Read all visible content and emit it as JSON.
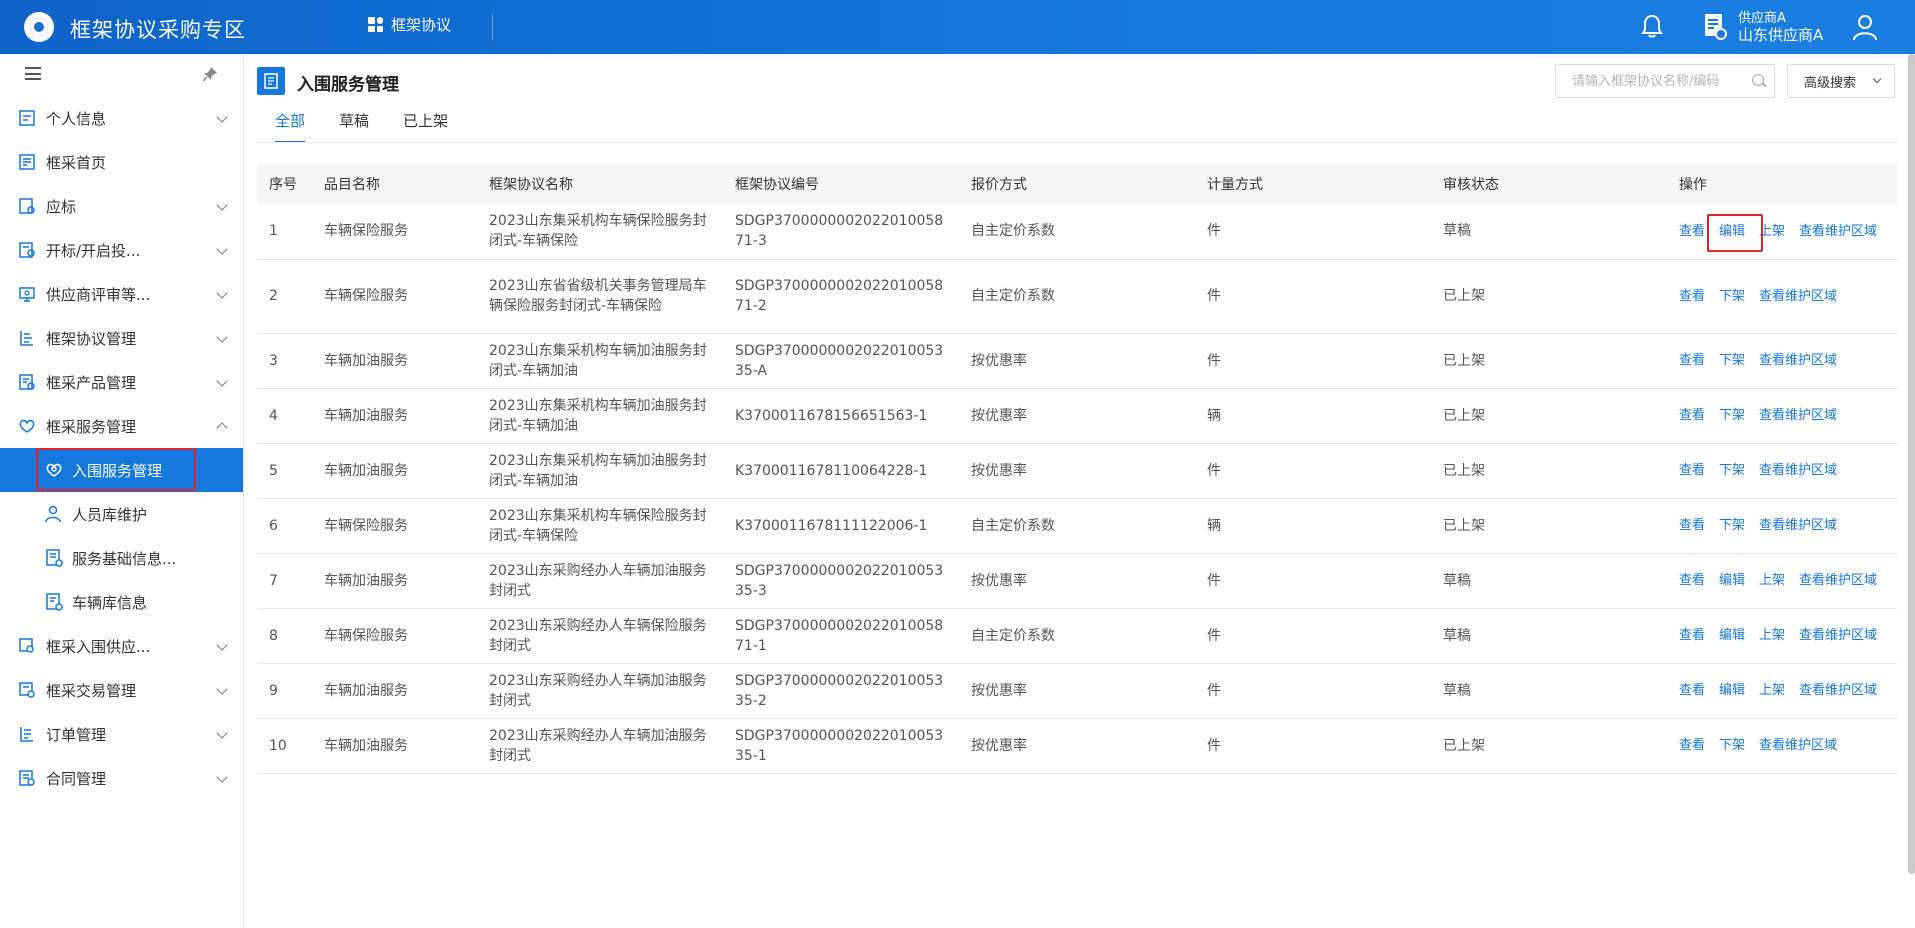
{
  "header": {
    "app_title": "框架协议采购专区",
    "nav_item": "框架协议",
    "user_role": "供应商A",
    "user_org": "山东供应商A"
  },
  "sidebar": {
    "items": [
      {
        "label": "个人信息",
        "icon": "user-card-icon",
        "expandable": true
      },
      {
        "label": "框采首页",
        "icon": "home-doc-icon",
        "expandable": false
      },
      {
        "label": "应标",
        "icon": "bid-icon",
        "expandable": true
      },
      {
        "label": "开标/开启投...",
        "icon": "open-bid-icon",
        "expandable": true
      },
      {
        "label": "供应商评审等...",
        "icon": "review-icon",
        "expandable": true
      },
      {
        "label": "框架协议管理",
        "icon": "agreement-icon",
        "expandable": true
      },
      {
        "label": "框采产品管理",
        "icon": "product-icon",
        "expandable": true
      },
      {
        "label": "框采服务管理",
        "icon": "service-icon",
        "expandable": true,
        "expanded": true
      }
    ],
    "sub_items": [
      {
        "label": "入围服务管理",
        "icon": "service-heart-icon",
        "active": true
      },
      {
        "label": "人员库维护",
        "icon": "person-icon"
      },
      {
        "label": "服务基础信息...",
        "icon": "info-doc-icon"
      },
      {
        "label": "车辆库信息",
        "icon": "vehicle-doc-icon"
      }
    ],
    "items_after": [
      {
        "label": "框采入围供应...",
        "icon": "supplier-icon",
        "expandable": true
      },
      {
        "label": "框采交易管理",
        "icon": "trade-icon",
        "expandable": true
      },
      {
        "label": "订单管理",
        "icon": "order-icon",
        "expandable": true
      },
      {
        "label": "合同管理",
        "icon": "contract-icon",
        "expandable": true
      }
    ]
  },
  "main": {
    "page_title": "入围服务管理",
    "search_placeholder": "请输入框架协议名称/编码",
    "advanced_search": "高级搜索",
    "tabs": [
      {
        "label": "全部",
        "active": true
      },
      {
        "label": "草稿"
      },
      {
        "label": "已上架"
      }
    ],
    "columns": [
      "序号",
      "品目名称",
      "框架协议名称",
      "框架协议编号",
      "报价方式",
      "计量方式",
      "审核状态",
      "操作"
    ],
    "rows": [
      {
        "no": "1",
        "item": "车辆保险服务",
        "name": "2023山东集采机构车辆保险服务封闭式-车辆保险",
        "code": "SDGP370000000202201005871-3",
        "quote": "自主定价系数",
        "unit": "件",
        "status": "草稿",
        "ops": [
          "查看",
          "编辑",
          "上架",
          "查看维护区域"
        ]
      },
      {
        "no": "2",
        "item": "车辆保险服务",
        "name": "2023山东省省级机关事务管理局车辆保险服务封闭式-车辆保险",
        "code": "SDGP370000000202201005871-2",
        "quote": "自主定价系数",
        "unit": "件",
        "status": "已上架",
        "ops": [
          "查看",
          "下架",
          "查看维护区域"
        ]
      },
      {
        "no": "3",
        "item": "车辆加油服务",
        "name": "2023山东集采机构车辆加油服务封闭式-车辆加油",
        "code": "SDGP370000000202201005335-A",
        "quote": "按优惠率",
        "unit": "件",
        "status": "已上架",
        "ops": [
          "查看",
          "下架",
          "查看维护区域"
        ]
      },
      {
        "no": "4",
        "item": "车辆加油服务",
        "name": "2023山东集采机构车辆加油服务封闭式-车辆加油",
        "code": "K3700011678156651563-1",
        "quote": "按优惠率",
        "unit": "辆",
        "status": "已上架",
        "ops": [
          "查看",
          "下架",
          "查看维护区域"
        ]
      },
      {
        "no": "5",
        "item": "车辆加油服务",
        "name": "2023山东集采机构车辆加油服务封闭式-车辆加油",
        "code": "K3700011678110064228-1",
        "quote": "按优惠率",
        "unit": "件",
        "status": "已上架",
        "ops": [
          "查看",
          "下架",
          "查看维护区域"
        ]
      },
      {
        "no": "6",
        "item": "车辆保险服务",
        "name": "2023山东集采机构车辆保险服务封闭式-车辆保险",
        "code": "K3700011678111122006-1",
        "quote": "自主定价系数",
        "unit": "辆",
        "status": "已上架",
        "ops": [
          "查看",
          "下架",
          "查看维护区域"
        ]
      },
      {
        "no": "7",
        "item": "车辆加油服务",
        "name": "2023山东采购经办人车辆加油服务封闭式",
        "code": "SDGP370000000202201005335-3",
        "quote": "按优惠率",
        "unit": "件",
        "status": "草稿",
        "ops": [
          "查看",
          "编辑",
          "上架",
          "查看维护区域"
        ]
      },
      {
        "no": "8",
        "item": "车辆保险服务",
        "name": "2023山东采购经办人车辆保险服务封闭式",
        "code": "SDGP370000000202201005871-1",
        "quote": "自主定价系数",
        "unit": "件",
        "status": "草稿",
        "ops": [
          "查看",
          "编辑",
          "上架",
          "查看维护区域"
        ]
      },
      {
        "no": "9",
        "item": "车辆加油服务",
        "name": "2023山东采购经办人车辆加油服务封闭式",
        "code": "SDGP370000000202201005335-2",
        "quote": "按优惠率",
        "unit": "件",
        "status": "草稿",
        "ops": [
          "查看",
          "编辑",
          "上架",
          "查看维护区域"
        ]
      },
      {
        "no": "10",
        "item": "车辆加油服务",
        "name": "2023山东采购经办人车辆加油服务封闭式",
        "code": "SDGP370000000202201005335-1",
        "quote": "按优惠率",
        "unit": "件",
        "status": "已上架",
        "ops": [
          "查看",
          "下架",
          "查看维护区域"
        ]
      }
    ]
  },
  "colors": {
    "primary": "#1677dc",
    "header_gradient_start": "#0e63c8",
    "highlight_red": "#e0242b"
  }
}
